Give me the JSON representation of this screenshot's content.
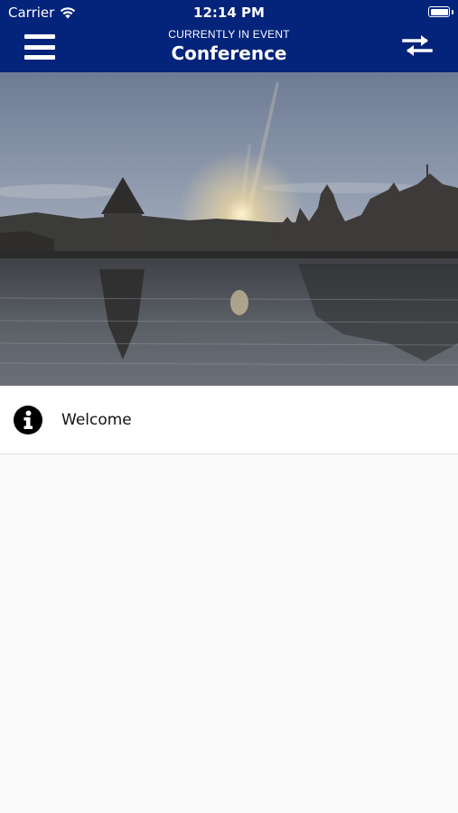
{
  "status_bar": {
    "carrier": "Carrier",
    "time": "12:14 PM"
  },
  "header": {
    "subtitle": "CURRENTLY IN EVENT",
    "title": "Conference"
  },
  "icons": {
    "menu": "hamburger-menu-icon",
    "switch": "swap-arrows-icon",
    "info": "info-circle-icon",
    "wifi": "wifi-icon",
    "battery": "battery-icon"
  },
  "colors": {
    "header_bg": "#04237a",
    "background": "#fafafa"
  },
  "menu_items": [
    {
      "label": "Welcome",
      "icon": "info-circle-icon"
    }
  ]
}
